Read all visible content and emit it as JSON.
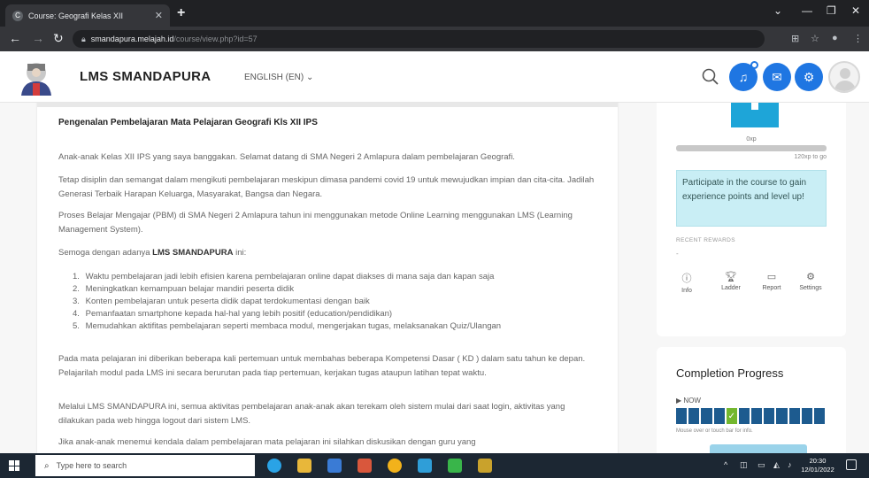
{
  "browser": {
    "tab_title": "Course: Geografi Kelas XII",
    "tab_favicon_letter": "C",
    "new_tab": "+",
    "url_host": "smandapura.melajah.id",
    "url_path": "/course/view.php?id=57"
  },
  "header": {
    "site_name": "LMS SMANDAPURA",
    "language": "ENGLISH (EN)",
    "accent_color": "#1f76e2"
  },
  "main": {
    "intro_title": "Pengenalan Pembelajaran Mata Pelajaran Geografi Kls XII IPS",
    "para1": "Anak-anak Kelas XII IPS yang saya banggakan. Selamat datang di SMA Negeri 2 Amlapura dalam pembelajaran Geografi.",
    "para2": "Tetap disiplin dan semangat dalam mengikuti pembelajaran meskipun dimasa pandemi covid 19 untuk mewujudkan impian dan cita-cita. Jadilah Generasi Terbaik Harapan Keluarga, Masyarakat, Bangsa dan Negara.",
    "para3": "Proses Belajar Mengajar (PBM) di SMA Negeri 2 Amlapura tahun ini  menggunakan metode Online Learning menggunakan LMS (Learning Management System).",
    "para4_prefix": "Semoga dengan adanya ",
    "para4_bold": "LMS SMANDAPURA",
    "para4_suffix": " ini:",
    "list": [
      {
        "num": "1.",
        "text": "Waktu pembelajaran jadi lebih efisien karena pembelajaran online dapat diakses di mana saja dan kapan saja"
      },
      {
        "num": "2.",
        "text": "Meningkatkan kemampuan belajar mandiri peserta didik"
      },
      {
        "num": "3.",
        "text": "Konten pembelajaran untuk peserta didik dapat terdokumentasi dengan baik"
      },
      {
        "num": "4.",
        "text": "Pemanfaatan smartphone kepada hal-hal yang lebih positif (education/pendidikan)"
      },
      {
        "num": "5.",
        "text": "Memudahkan aktifitas pembelajaran seperti membaca modul, mengerjakan tugas, melaksanakan Quiz/Ulangan"
      }
    ],
    "para5": "Pada mata pelajaran ini diberikan beberapa kali pertemuan untuk membahas beberapa Kompetensi Dasar ( KD ) dalam satu tahun ke depan. Pelajarilah modul pada LMS ini secara berurutan pada tiap pertemuan, kerjakan tugas ataupun latihan tepat waktu.",
    "para6": "Melalui LMS SMANDAPURA ini, semua aktivitas pembelajaran anak-anak akan terekam oleh sistem mulai dari saat login, aktivitas yang dilakukan pada web hingga logout dari sistem LMS.",
    "para7": "Jika anak-anak menemui kendala dalam pembelajaran mata pelajaran ini silahkan diskusikan dengan guru yang"
  },
  "levelup": {
    "xp": "0xp",
    "xp_progress_fraction": 0,
    "to_go": "120xp to go",
    "participate_text": "Participate in the course to gain experience points and level up!",
    "recent_rewards": "RECENT REWARDS",
    "recent_dash": "-",
    "actions": [
      "Info",
      "Ladder",
      "Report",
      "Settings"
    ]
  },
  "completion": {
    "title": "Completion Progress",
    "now_label": "NOW",
    "hover_hint": "Mouse over or touch bar for info.",
    "segments_total": 12,
    "segments_done_index": 4
  },
  "taskbar": {
    "search_placeholder": "Type here to search",
    "time": "20:30",
    "date": "12/01/2022"
  }
}
